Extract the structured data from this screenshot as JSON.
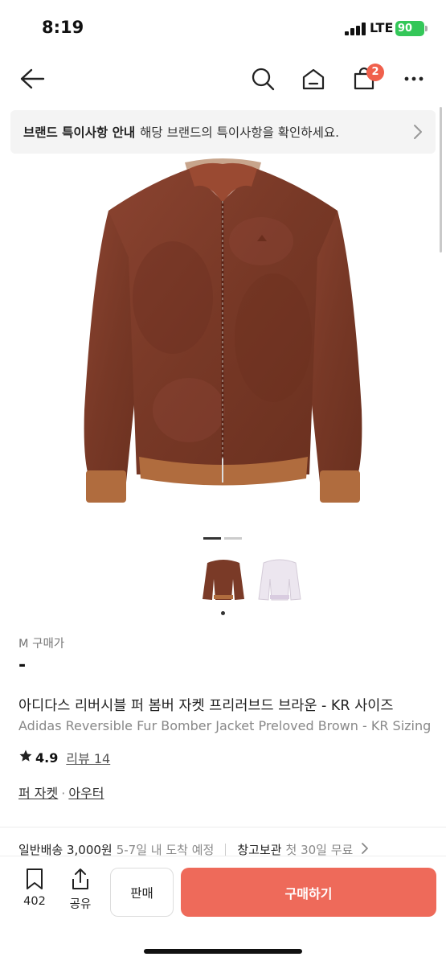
{
  "status_bar": {
    "time": "8:19",
    "network": "LTE",
    "battery": "90"
  },
  "nav": {
    "cart_count": "2"
  },
  "notice": {
    "bold": "브랜드 특이사항 안내",
    "text": "해당 브랜드의 특이사항을 확인하세요."
  },
  "product": {
    "size_label": "M 구매가",
    "price": "-",
    "title_ko": "아디다스 리버시블 퍼 봄버 자켓 프리러브드 브라운 - KR 사이즈",
    "title_en": "Adidas Reversible Fur Bomber Jacket Preloved Brown - KR Sizing",
    "rating": "4.9",
    "review": "리뷰 14",
    "category_1": "퍼 자켓",
    "category_sep": "·",
    "category_2": "아우터",
    "image_count": 2,
    "active_image": 1,
    "main_color": "#7a3a27"
  },
  "shipping": {
    "label": "일반배송 3,000원",
    "eta": "5-7일 내 도착 예정",
    "storage_label": "창고보관",
    "storage_desc": "첫 30일 무료"
  },
  "bottom": {
    "bookmark_count": "402",
    "share_label": "공유",
    "sell_label": "판매",
    "buy_label": "구매하기",
    "buy_color": "#ee6a5a"
  }
}
